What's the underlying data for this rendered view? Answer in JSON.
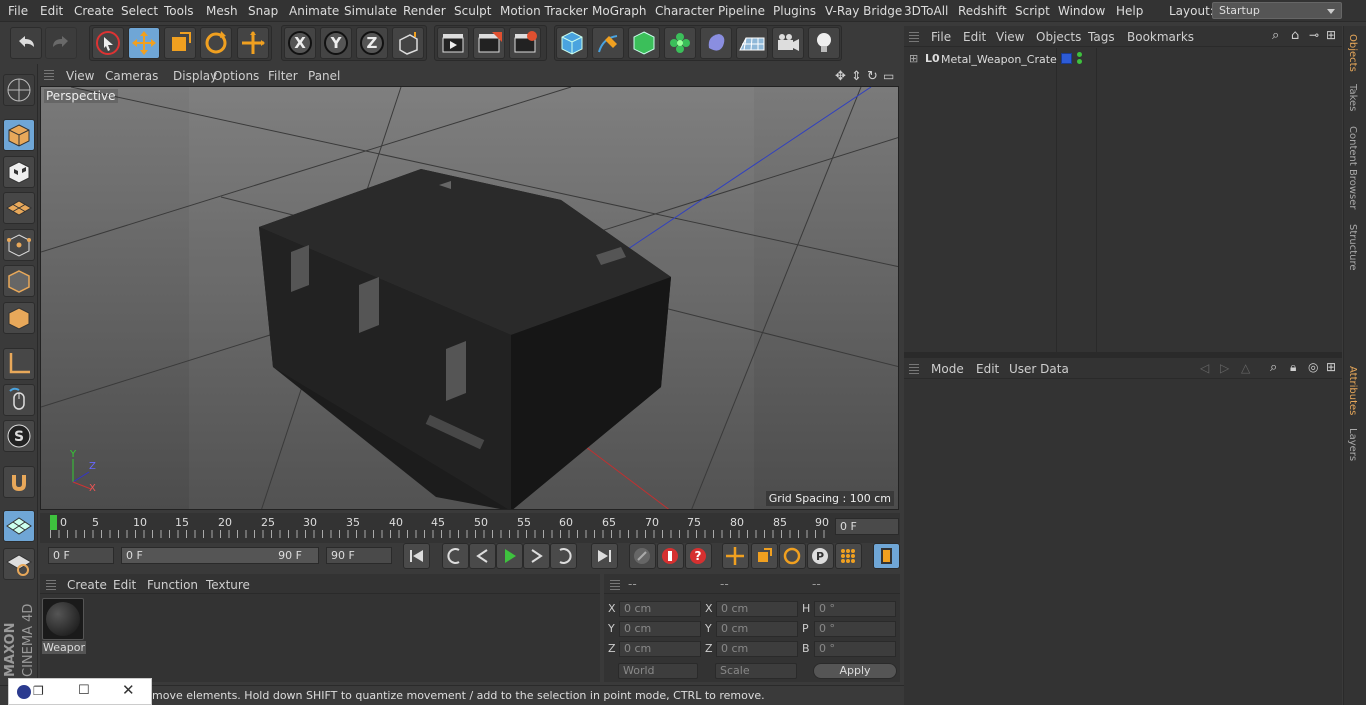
{
  "menu": {
    "items": [
      "File",
      "Edit",
      "Create",
      "Select",
      "Tools",
      "Mesh",
      "Snap",
      "Animate",
      "Simulate",
      "Render",
      "Sculpt",
      "Motion Tracker",
      "MoGraph",
      "Character",
      "Pipeline",
      "Plugins",
      "V-Ray Bridge",
      "3DToAll",
      "Redshift",
      "Script",
      "Window",
      "Help"
    ],
    "layout_label": "Layout:",
    "layout_value": "Startup"
  },
  "viewport": {
    "menu": [
      "View",
      "Cameras",
      "Display",
      "Options",
      "Filter",
      "Panel"
    ],
    "label": "Perspective",
    "grid_spacing": "Grid Spacing : 100 cm",
    "axis_labels": {
      "y": "Y",
      "z": "Z",
      "x": "X"
    }
  },
  "timeline": {
    "ticks": [
      "0",
      "5",
      "10",
      "15",
      "20",
      "25",
      "30",
      "35",
      "40",
      "45",
      "50",
      "55",
      "60",
      "65",
      "70",
      "75",
      "80",
      "85",
      "90"
    ],
    "current_frame": "0 F",
    "start_frame": "0 F",
    "range_start": "0 F",
    "range_end": "90 F",
    "end_frame": "90 F"
  },
  "material_panel": {
    "menu": [
      "Create",
      "Edit",
      "Function",
      "Texture"
    ],
    "materials": [
      {
        "name": "Weapor"
      }
    ]
  },
  "coord_panel": {
    "headers": [
      "--",
      "--",
      "--"
    ],
    "rows": [
      {
        "l1": "X",
        "v1": "0 cm",
        "l2": "X",
        "v2": "0 cm",
        "l3": "H",
        "v3": "0 °"
      },
      {
        "l1": "Y",
        "v1": "0 cm",
        "l2": "Y",
        "v2": "0 cm",
        "l3": "P",
        "v3": "0 °"
      },
      {
        "l1": "Z",
        "v1": "0 cm",
        "l2": "Z",
        "v2": "0 cm",
        "l3": "B",
        "v3": "0 °"
      }
    ],
    "space": "World",
    "mode": "Scale",
    "apply": "Apply"
  },
  "objects_panel": {
    "menu": [
      "File",
      "Edit",
      "View",
      "Objects",
      "Tags",
      "Bookmarks"
    ],
    "objects": [
      {
        "name": "Metal_Weapon_Crate"
      }
    ]
  },
  "attributes_panel": {
    "menu": [
      "Mode",
      "Edit",
      "User Data"
    ]
  },
  "side_tabs": [
    "Objects",
    "Takes",
    "Content Browser",
    "Structure"
  ],
  "side_tabs_lower": [
    "Attributes",
    "Layers"
  ],
  "status": "move elements. Hold down SHIFT to quantize movement / add to the selection in point mode, CTRL to remove.",
  "brand": {
    "line1": "MAXON",
    "line2": "CINEMA 4D"
  },
  "colors": {
    "accent": "#6fa6d6",
    "selected_tab": "#e8a85a",
    "play": "#3ec23e"
  }
}
